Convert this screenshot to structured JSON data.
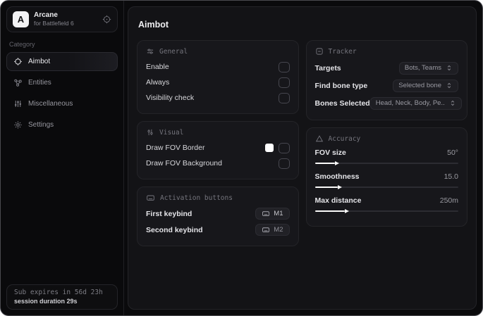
{
  "app": {
    "logo_letter": "A",
    "name": "Arcane",
    "subtitle": "for Battlefield 6"
  },
  "sidebar": {
    "category_label": "Category",
    "items": [
      {
        "label": "Aimbot",
        "icon": "crosshair-icon",
        "active": true
      },
      {
        "label": "Entities",
        "icon": "entities-icon",
        "active": false
      },
      {
        "label": "Miscellaneous",
        "icon": "equalizer-icon",
        "active": false
      },
      {
        "label": "Settings",
        "icon": "gear-icon",
        "active": false
      }
    ],
    "footer": {
      "sub_expires": "Sub expires in 56d 23h",
      "session_duration": "session duration 29s"
    }
  },
  "main": {
    "title": "Aimbot",
    "sections": {
      "general": {
        "title": "General",
        "rows": [
          {
            "label": "Enable",
            "checked": false
          },
          {
            "label": "Always",
            "checked": false
          },
          {
            "label": "Visibility check",
            "checked": false
          }
        ]
      },
      "visual": {
        "title": "Visual",
        "rows": [
          {
            "label": "Draw FOV Border",
            "swatch_color": "#ffffff",
            "checked": false
          },
          {
            "label": "Draw FOV Background",
            "checked": false
          }
        ]
      },
      "activation": {
        "title": "Activation buttons",
        "rows": [
          {
            "label": "First keybind",
            "key": "M1"
          },
          {
            "label": "Second keybind",
            "key": "M2"
          }
        ]
      },
      "tracker": {
        "title": "Tracker",
        "rows": [
          {
            "label": "Targets",
            "value": "Bots, Teams"
          },
          {
            "label": "Find bone type",
            "value": "Selected bone"
          },
          {
            "label": "Bones Selected",
            "value": "Head, Neck, Body, Pe.."
          }
        ]
      },
      "accuracy": {
        "title": "Accuracy",
        "sliders": [
          {
            "label": "FOV size",
            "value": "50°",
            "percent": 14
          },
          {
            "label": "Smoothness",
            "value": "15.0",
            "percent": 16
          },
          {
            "label": "Max distance",
            "value": "250m",
            "percent": 21
          }
        ]
      }
    }
  },
  "colors": {
    "accent_swatch": "#ffffff",
    "card_bg": "#17171b",
    "panel_bg": "#131316"
  }
}
